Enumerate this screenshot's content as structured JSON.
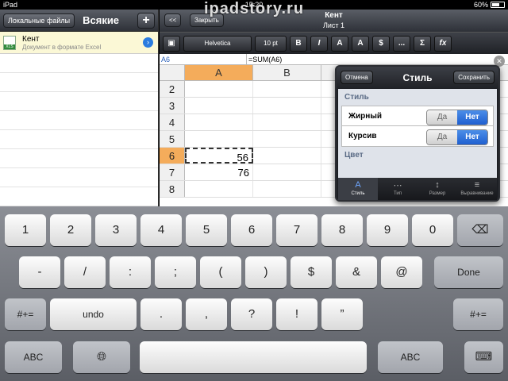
{
  "status_bar": {
    "carrier": "iPad",
    "time": "15:20",
    "battery": "60%"
  },
  "watermark": "ipadstory.ru",
  "left_pane": {
    "location_button": "Локальные файлы",
    "title": "Всякие",
    "add_button": "+",
    "files": [
      {
        "name": "Кент",
        "description": "Документ в формате Excel",
        "icon_text": "XLS"
      }
    ]
  },
  "right_pane": {
    "back_button": "<<",
    "close_button": "Закрыть",
    "doc_title": "Кент",
    "sheet_name": "Лист 1",
    "toolbar": {
      "font": "Helvetica",
      "size": "10 pt",
      "bold": "B",
      "italic": "I",
      "sum": "Σ",
      "fx": "fx",
      "more": "..."
    },
    "formula_bar": {
      "cell_ref": "A6",
      "formula": "=SUM(A6)"
    },
    "columns": [
      "A",
      "B"
    ],
    "rows": [
      {
        "num": "2",
        "a": "",
        "b": ""
      },
      {
        "num": "3",
        "a": "",
        "b": ""
      },
      {
        "num": "4",
        "a": "",
        "b": ""
      },
      {
        "num": "5",
        "a": "",
        "b": ""
      },
      {
        "num": "6",
        "a": "56",
        "b": ""
      },
      {
        "num": "7",
        "a": "76",
        "b": ""
      },
      {
        "num": "8",
        "a": "",
        "b": ""
      }
    ]
  },
  "popover": {
    "cancel_button": "Отмена",
    "title": "Стиль",
    "save_button": "Сохранить",
    "section_style": "Стиль",
    "bold_label": "Жирный",
    "italic_label": "Курсив",
    "yes": "Да",
    "no": "Нет",
    "section_color": "Цвет",
    "tabs": [
      "Стиль",
      "Тип",
      "Размер",
      "Выравнивание"
    ]
  },
  "keyboard": {
    "row1": [
      "1",
      "2",
      "3",
      "4",
      "5",
      "6",
      "7",
      "8",
      "9",
      "0"
    ],
    "row2": [
      "-",
      "/",
      ":",
      ";",
      "(",
      ")",
      "$",
      "&",
      "@"
    ],
    "row3_middle": [
      "undo",
      ".",
      ",",
      "?",
      "!",
      "”"
    ],
    "done": "Done",
    "shift_sym": "#+=",
    "abc": "ABC"
  }
}
